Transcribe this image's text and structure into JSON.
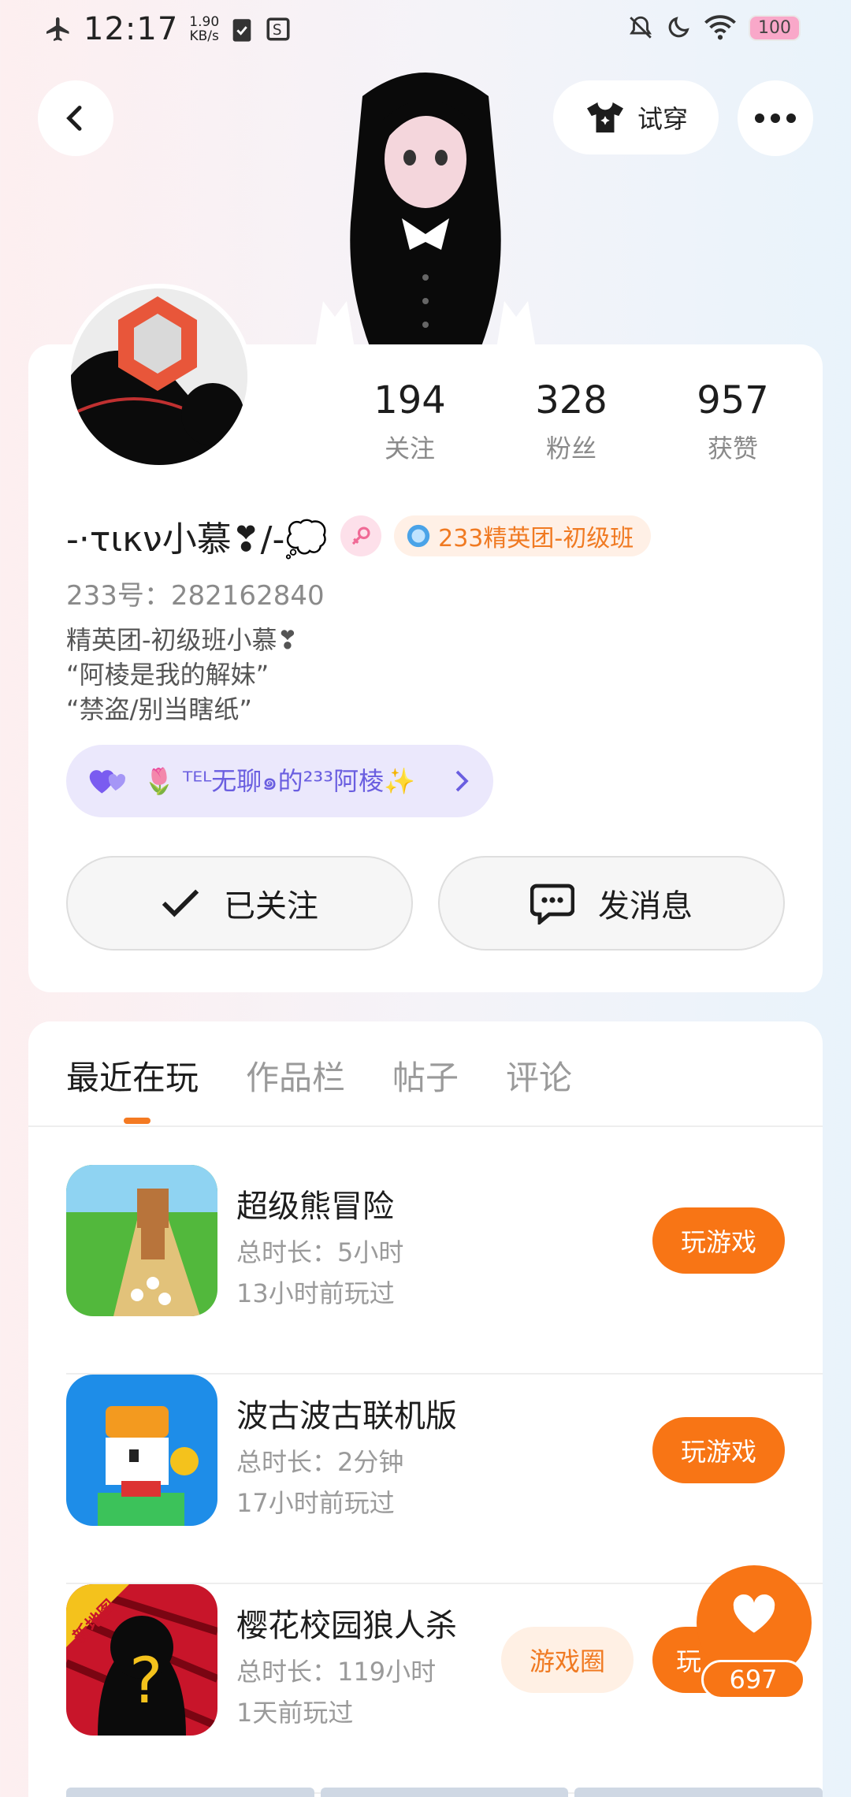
{
  "status_bar": {
    "time": "12:17",
    "speed_value": "1.90",
    "speed_unit": "KB/s",
    "battery": "100"
  },
  "hero": {
    "try_on_label": "试穿"
  },
  "profile": {
    "stats": [
      {
        "value": "194",
        "label": "关注"
      },
      {
        "value": "328",
        "label": "粉丝"
      },
      {
        "value": "957",
        "label": "获赞"
      }
    ],
    "nickname": "-·τικν小慕❣/-💭",
    "group_badge": "233精英团-初级班",
    "uid_label": "233号：",
    "uid": "282162840",
    "bio_lines": [
      "精英团-初级班小慕❣",
      "“阿棱是我的解妹”",
      "“禁盗/别当瞎纸”"
    ],
    "family": "🌷 ᵀᴱᴸ无聊๑的²³³阿棱✨",
    "follow_label": "已关注",
    "message_label": "发消息"
  },
  "tabs": [
    "最近在玩",
    "作品栏",
    "帖子",
    "评论"
  ],
  "games": [
    {
      "name": "超级熊冒险",
      "duration": "总时长：5小时",
      "last_played": "13小时前玩过",
      "play_label": "玩游戏"
    },
    {
      "name": "波古波古联机版",
      "duration": "总时长：2分钟",
      "last_played": "17小时前玩过",
      "play_label": "玩游戏"
    },
    {
      "name": "樱花校园狼人杀",
      "duration": "总时长：119小时",
      "last_played": "1天前玩过",
      "play_label": "玩",
      "circle_label": "游戏圈",
      "tag": "新地图"
    }
  ],
  "like_count": "697",
  "colors": {
    "accent": "#f87515",
    "family_pill": "#ebe8fc",
    "family_text": "#6a5ee0"
  }
}
